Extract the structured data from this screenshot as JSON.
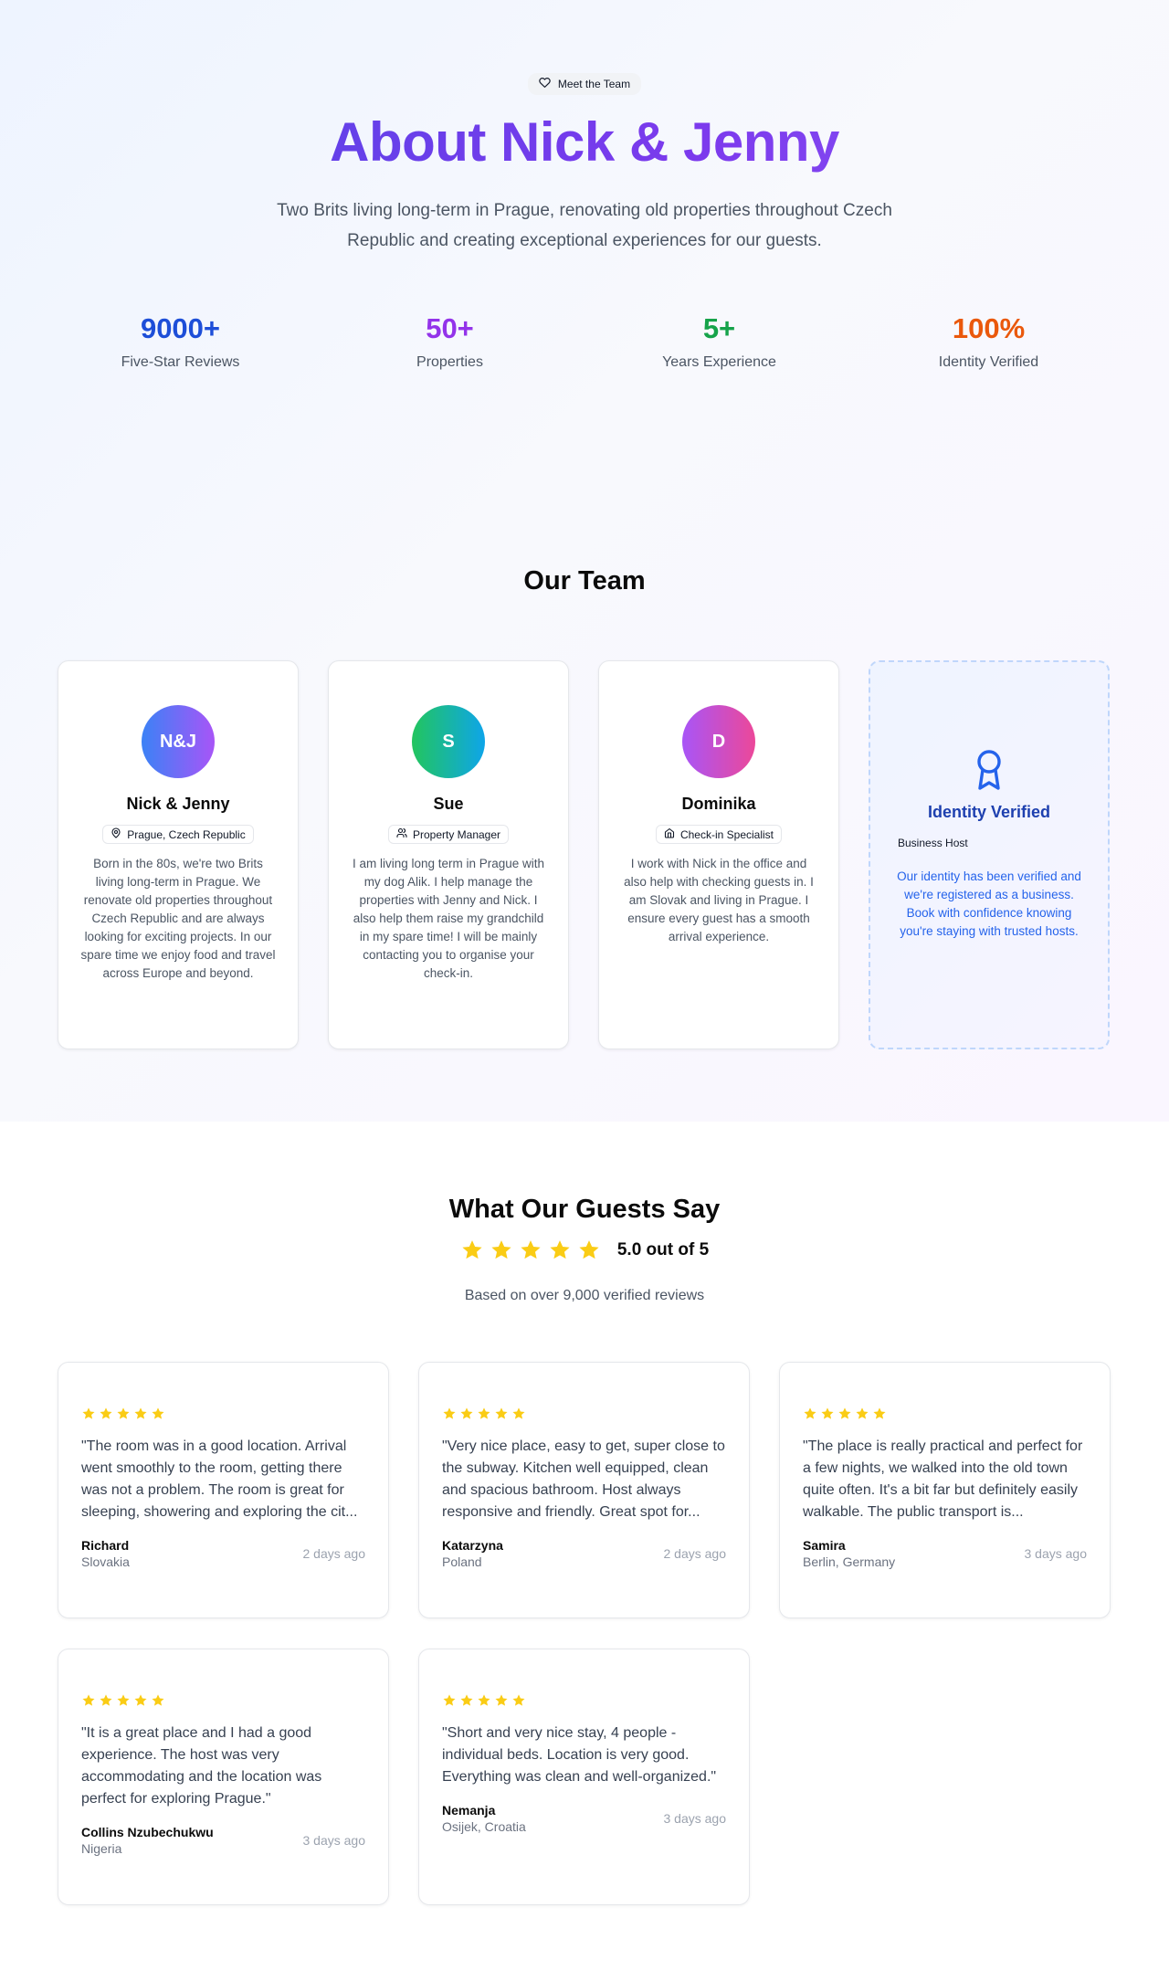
{
  "hero": {
    "badge": "Meet the Team",
    "title": "About Nick & Jenny",
    "subtitle": "Two Brits living long-term in Prague, renovating old properties throughout Czech Republic and creating exceptional experiences for our guests."
  },
  "stats": [
    {
      "value": "9000+",
      "label": "Five-Star Reviews",
      "color": "#1d4ed8"
    },
    {
      "value": "50+",
      "label": "Properties",
      "color": "#9333ea"
    },
    {
      "value": "5+",
      "label": "Years Experience",
      "color": "#16a34a"
    },
    {
      "value": "100%",
      "label": "Identity Verified",
      "color": "#ea580c"
    }
  ],
  "team": {
    "title": "Our Team",
    "members": [
      {
        "initials": "N&J",
        "name": "Nick & Jenny",
        "role": "Prague, Czech Republic",
        "role_icon": "map-pin-icon",
        "bio": "Born in the 80s, we're two Brits living long-term in Prague. We renovate old properties throughout Czech Republic and are always looking for exciting projects. In our spare time we enjoy food and travel across Europe and beyond."
      },
      {
        "initials": "S",
        "name": "Sue",
        "role": "Property Manager",
        "role_icon": "users-icon",
        "bio": "I am living long term in Prague with my dog Alik. I help manage the properties with Jenny and Nick. I also help them raise my grandchild in my spare time! I will be mainly contacting you to organise your check-in."
      },
      {
        "initials": "D",
        "name": "Dominika",
        "role": "Check-in Specialist",
        "role_icon": "home-icon",
        "bio": "I work with Nick in the office and also help with checking guests in. I am Slovak and living in Prague. I ensure every guest has a smooth arrival experience."
      }
    ],
    "verified": {
      "title": "Identity Verified",
      "badge": "Business Host",
      "text": "Our identity has been verified and we're registered as a business. Book with confidence knowing you're staying with trusted hosts."
    }
  },
  "reviews": {
    "title": "What Our Guests Say",
    "rating": "5.0 out of 5",
    "rating_stars": 5,
    "based_on": "Based on over 9,000 verified reviews",
    "items": [
      {
        "quote": "\"The room was in a good location. Arrival went smoothly to the room, getting there was not a problem. The room is great for sleeping, showering and exploring the cit...",
        "name": "Richard",
        "location": "Slovakia",
        "time": "2 days ago",
        "stars": 5
      },
      {
        "quote": "\"Very nice place, easy to get, super close to the subway. Kitchen well equipped, clean and spacious bathroom. Host always responsive and friendly. Great spot for...",
        "name": "Katarzyna",
        "location": "Poland",
        "time": "2 days ago",
        "stars": 5
      },
      {
        "quote": "\"The place is really practical and perfect for a few nights, we walked into the old town quite often. It's a bit far but definitely easily walkable. The public transport is...",
        "name": "Samira",
        "location": "Berlin, Germany",
        "time": "3 days ago",
        "stars": 5
      },
      {
        "quote": "\"It is a great place and I had a good experience. The host was very accommodating and the location was perfect for exploring Prague.\"",
        "name": "Collins Nzubechukwu",
        "location": "Nigeria",
        "time": "3 days ago",
        "stars": 5
      },
      {
        "quote": "\"Short and very nice stay, 4 people - individual beds. Location is very good. Everything was clean and well-organized.\"",
        "name": "Nemanja",
        "location": "Osijek, Croatia",
        "time": "3 days ago",
        "stars": 5
      }
    ]
  },
  "colors": {
    "star": "#facc15",
    "avatar_gradients": [
      [
        "#3b82f6",
        "#a855f7"
      ],
      [
        "#22c55e",
        "#0ea5e9"
      ],
      [
        "#a855f7",
        "#ec4899"
      ]
    ]
  }
}
